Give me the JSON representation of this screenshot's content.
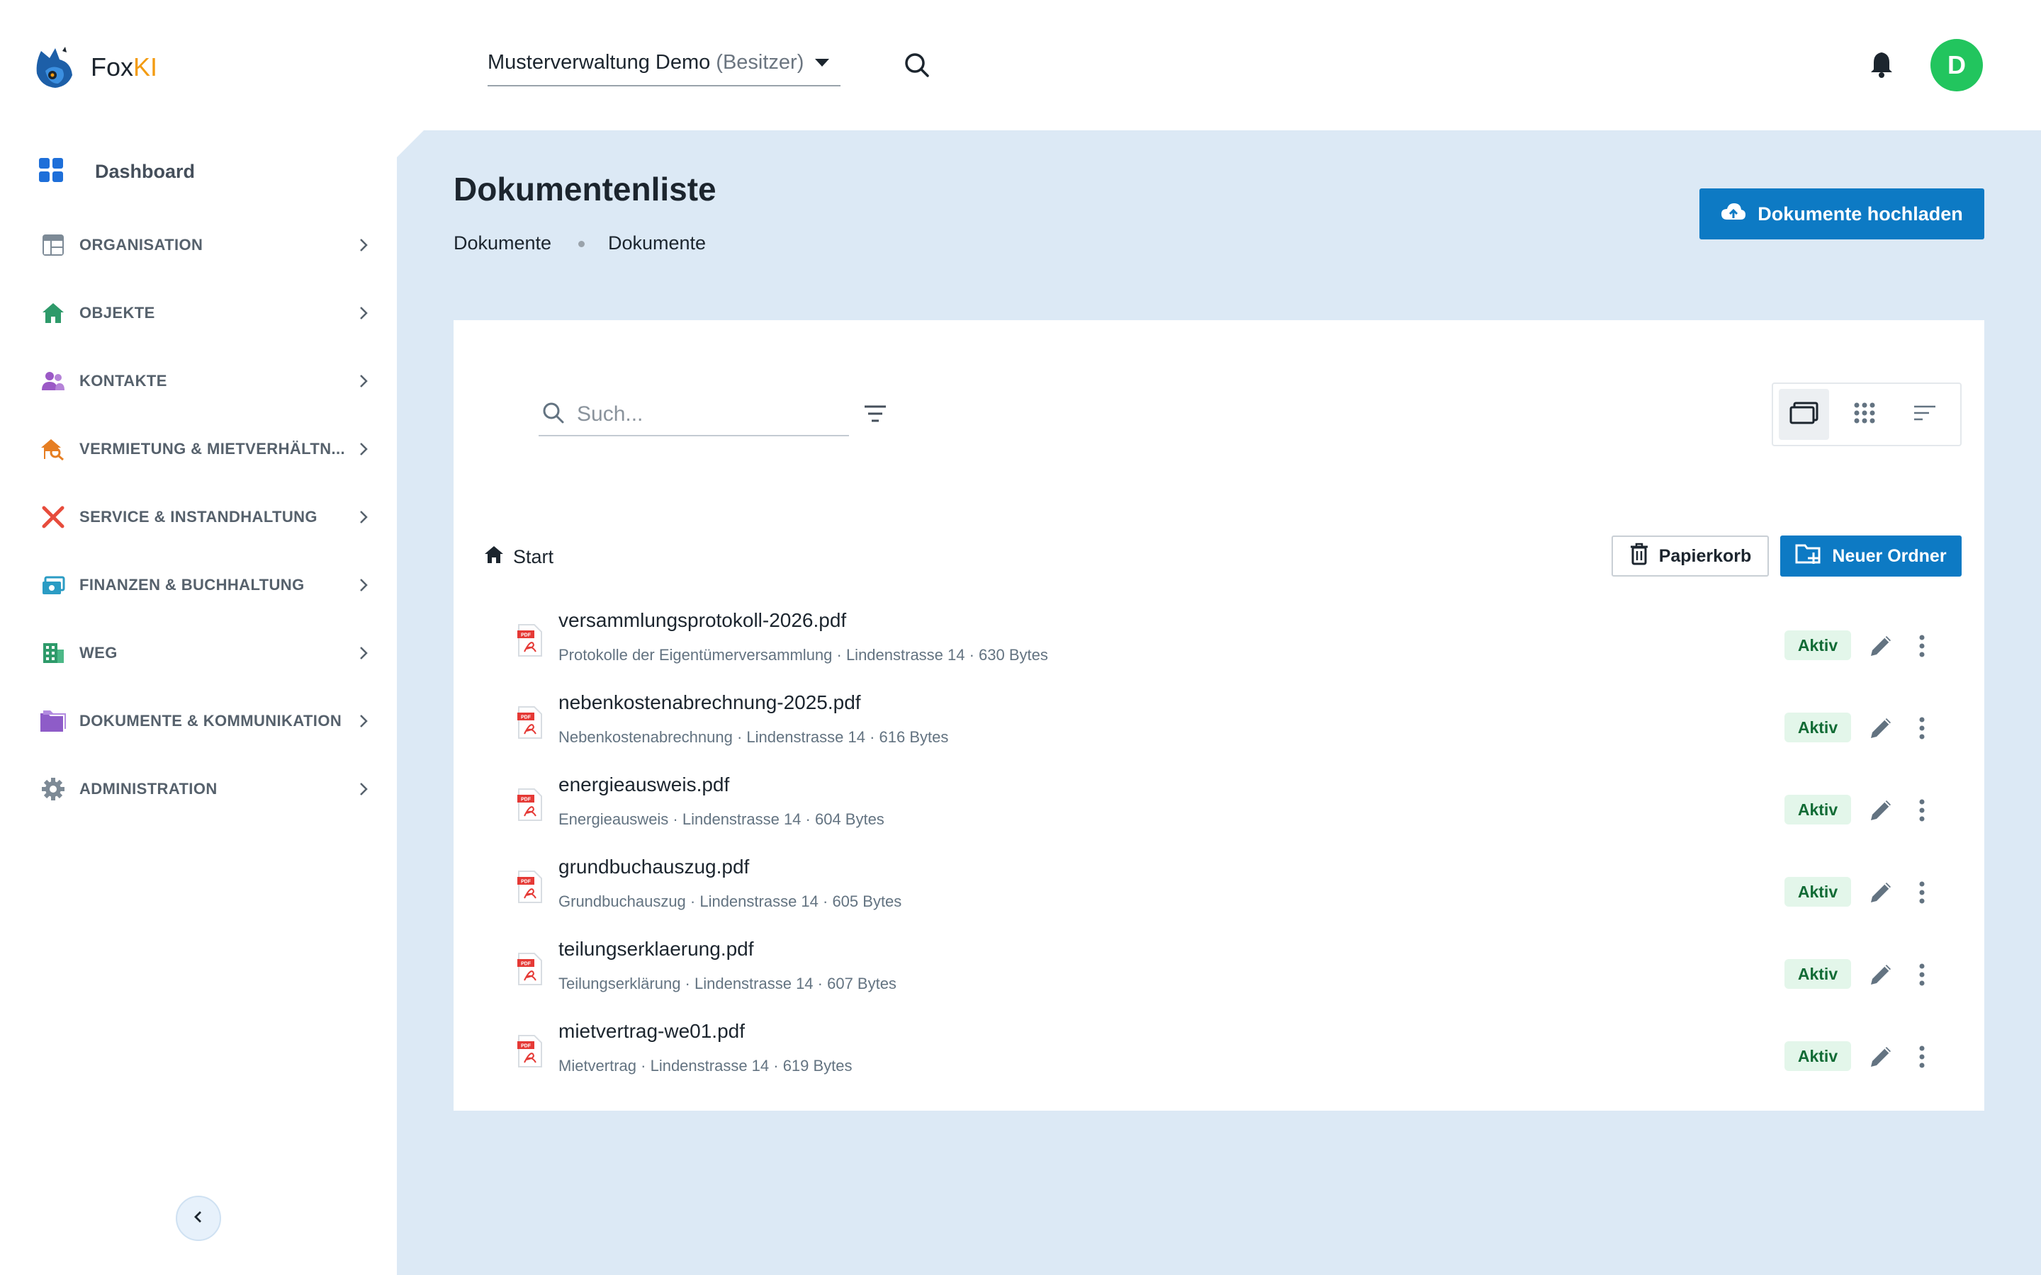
{
  "app": {
    "brand_prefix": "Fox",
    "brand_suffix": "KI",
    "accent_color": "#0d7ac4",
    "avatar_color": "#22c55e"
  },
  "header": {
    "org_name": "Musterverwaltung Demo",
    "org_role": "(Besitzer)",
    "avatar_letter": "D"
  },
  "sidebar": {
    "dashboard_label": "Dashboard",
    "items": [
      {
        "label": "ORGANISATION",
        "icon": "layout-icon"
      },
      {
        "label": "OBJEKTE",
        "icon": "home-icon"
      },
      {
        "label": "KONTAKTE",
        "icon": "people-icon"
      },
      {
        "label": "VERMIETUNG & MIETVERHÄLTN...",
        "icon": "house-search-icon"
      },
      {
        "label": "SERVICE & INSTANDHALTUNG",
        "icon": "tools-icon"
      },
      {
        "label": "FINANZEN & BUCHHALTUNG",
        "icon": "money-icon"
      },
      {
        "label": "WEG",
        "icon": "building-icon"
      },
      {
        "label": "DOKUMENTE & KOMMUNIKATION",
        "icon": "folder-icon"
      },
      {
        "label": "ADMINISTRATION",
        "icon": "gear-icon"
      }
    ]
  },
  "page": {
    "title": "Dokumentenliste",
    "breadcrumb": [
      "Dokumente",
      "Dokumente"
    ],
    "upload_label": "Dokumente hochladen"
  },
  "toolbar": {
    "search_placeholder": "Such...",
    "home_label": "Start",
    "trash_label": "Papierkorb",
    "new_folder_label": "Neuer Ordner"
  },
  "documents": [
    {
      "name": "versammlungsprotokoll-2026.pdf",
      "meta": "Protokolle der Eigentümerversammlung · Lindenstrasse 14 · 630 Bytes",
      "status": "Aktiv"
    },
    {
      "name": "nebenkostenabrechnung-2025.pdf",
      "meta": "Nebenkostenabrechnung · Lindenstrasse 14 · 616 Bytes",
      "status": "Aktiv"
    },
    {
      "name": "energieausweis.pdf",
      "meta": "Energieausweis · Lindenstrasse 14 · 604 Bytes",
      "status": "Aktiv"
    },
    {
      "name": "grundbuchauszug.pdf",
      "meta": "Grundbuchauszug · Lindenstrasse 14 · 605 Bytes",
      "status": "Aktiv"
    },
    {
      "name": "teilungserklaerung.pdf",
      "meta": "Teilungserklärung · Lindenstrasse 14 · 607 Bytes",
      "status": "Aktiv"
    },
    {
      "name": "mietvertrag-we01.pdf",
      "meta": "Mietvertrag · Lindenstrasse 14 · 619 Bytes",
      "status": "Aktiv"
    }
  ]
}
